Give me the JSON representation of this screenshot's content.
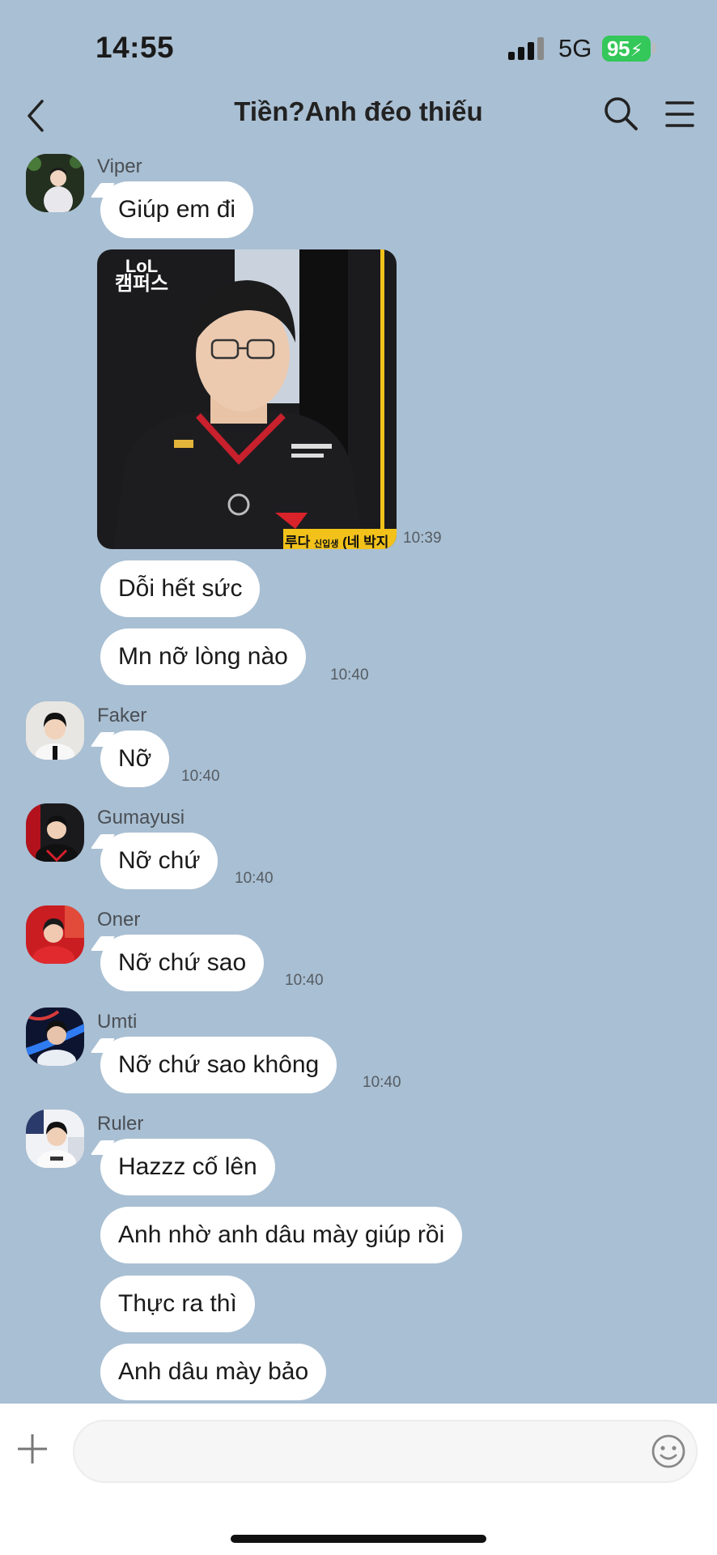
{
  "status_bar": {
    "time": "14:55",
    "network": "5G",
    "battery": "95"
  },
  "header": {
    "title": "Tiền?Anh đéo thiếu"
  },
  "messages": [
    {
      "sender": "Viper",
      "texts": [
        "Giúp em đi"
      ],
      "time": ""
    },
    {
      "sender": "",
      "image": "photo",
      "time": "10:39"
    },
    {
      "texts": [
        "Dỗi hết sức",
        "Mn nỡ lòng nào"
      ],
      "time": "10:40"
    },
    {
      "sender": "Faker",
      "texts": [
        "Nỡ"
      ],
      "time": "10:40"
    },
    {
      "sender": "Gumayusi",
      "texts": [
        "Nỡ chứ"
      ],
      "time": "10:40"
    },
    {
      "sender": "Oner",
      "texts": [
        "Nỡ chứ sao"
      ],
      "time": "10:40"
    },
    {
      "sender": "Umti",
      "texts": [
        "Nỡ chứ sao không"
      ],
      "time": "10:40"
    },
    {
      "sender": "Ruler",
      "texts": [
        "Hazzz cố lên",
        "Anh nhờ anh dâu mày giúp rồi",
        "Thực ra thì",
        "Anh dâu mày bảo"
      ]
    }
  ],
  "photo_caption": {
    "lol_line1": "LoL",
    "lol_line2": "캠퍼스",
    "subtitle_name": "루다",
    "subtitle_tag": "신입생",
    "subtitle_rest": "(네 박지"
  },
  "input": {
    "placeholder": ""
  },
  "colors": {
    "background": "#a9bfd3",
    "bubble": "#ffffff",
    "battery": "#34c759"
  },
  "icons": [
    "back-icon",
    "search-icon",
    "menu-icon",
    "plus-icon",
    "emoji-icon"
  ]
}
